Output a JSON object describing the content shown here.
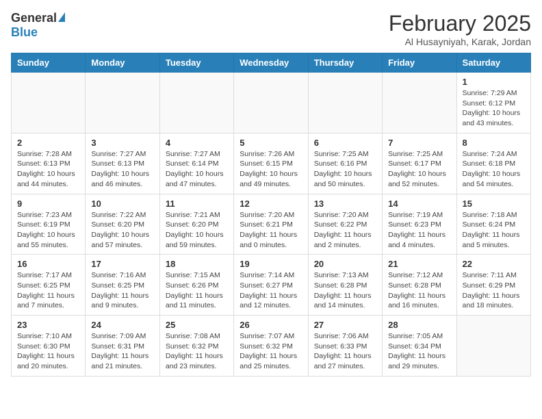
{
  "header": {
    "logo_general": "General",
    "logo_blue": "Blue",
    "month_title": "February 2025",
    "location": "Al Husayniyah, Karak, Jordan"
  },
  "weekdays": [
    "Sunday",
    "Monday",
    "Tuesday",
    "Wednesday",
    "Thursday",
    "Friday",
    "Saturday"
  ],
  "weeks": [
    [
      {
        "day": "",
        "info": ""
      },
      {
        "day": "",
        "info": ""
      },
      {
        "day": "",
        "info": ""
      },
      {
        "day": "",
        "info": ""
      },
      {
        "day": "",
        "info": ""
      },
      {
        "day": "",
        "info": ""
      },
      {
        "day": "1",
        "info": "Sunrise: 7:29 AM\nSunset: 6:12 PM\nDaylight: 10 hours\nand 43 minutes."
      }
    ],
    [
      {
        "day": "2",
        "info": "Sunrise: 7:28 AM\nSunset: 6:13 PM\nDaylight: 10 hours\nand 44 minutes."
      },
      {
        "day": "3",
        "info": "Sunrise: 7:27 AM\nSunset: 6:13 PM\nDaylight: 10 hours\nand 46 minutes."
      },
      {
        "day": "4",
        "info": "Sunrise: 7:27 AM\nSunset: 6:14 PM\nDaylight: 10 hours\nand 47 minutes."
      },
      {
        "day": "5",
        "info": "Sunrise: 7:26 AM\nSunset: 6:15 PM\nDaylight: 10 hours\nand 49 minutes."
      },
      {
        "day": "6",
        "info": "Sunrise: 7:25 AM\nSunset: 6:16 PM\nDaylight: 10 hours\nand 50 minutes."
      },
      {
        "day": "7",
        "info": "Sunrise: 7:25 AM\nSunset: 6:17 PM\nDaylight: 10 hours\nand 52 minutes."
      },
      {
        "day": "8",
        "info": "Sunrise: 7:24 AM\nSunset: 6:18 PM\nDaylight: 10 hours\nand 54 minutes."
      }
    ],
    [
      {
        "day": "9",
        "info": "Sunrise: 7:23 AM\nSunset: 6:19 PM\nDaylight: 10 hours\nand 55 minutes."
      },
      {
        "day": "10",
        "info": "Sunrise: 7:22 AM\nSunset: 6:20 PM\nDaylight: 10 hours\nand 57 minutes."
      },
      {
        "day": "11",
        "info": "Sunrise: 7:21 AM\nSunset: 6:20 PM\nDaylight: 10 hours\nand 59 minutes."
      },
      {
        "day": "12",
        "info": "Sunrise: 7:20 AM\nSunset: 6:21 PM\nDaylight: 11 hours\nand 0 minutes."
      },
      {
        "day": "13",
        "info": "Sunrise: 7:20 AM\nSunset: 6:22 PM\nDaylight: 11 hours\nand 2 minutes."
      },
      {
        "day": "14",
        "info": "Sunrise: 7:19 AM\nSunset: 6:23 PM\nDaylight: 11 hours\nand 4 minutes."
      },
      {
        "day": "15",
        "info": "Sunrise: 7:18 AM\nSunset: 6:24 PM\nDaylight: 11 hours\nand 5 minutes."
      }
    ],
    [
      {
        "day": "16",
        "info": "Sunrise: 7:17 AM\nSunset: 6:25 PM\nDaylight: 11 hours\nand 7 minutes."
      },
      {
        "day": "17",
        "info": "Sunrise: 7:16 AM\nSunset: 6:25 PM\nDaylight: 11 hours\nand 9 minutes."
      },
      {
        "day": "18",
        "info": "Sunrise: 7:15 AM\nSunset: 6:26 PM\nDaylight: 11 hours\nand 11 minutes."
      },
      {
        "day": "19",
        "info": "Sunrise: 7:14 AM\nSunset: 6:27 PM\nDaylight: 11 hours\nand 12 minutes."
      },
      {
        "day": "20",
        "info": "Sunrise: 7:13 AM\nSunset: 6:28 PM\nDaylight: 11 hours\nand 14 minutes."
      },
      {
        "day": "21",
        "info": "Sunrise: 7:12 AM\nSunset: 6:28 PM\nDaylight: 11 hours\nand 16 minutes."
      },
      {
        "day": "22",
        "info": "Sunrise: 7:11 AM\nSunset: 6:29 PM\nDaylight: 11 hours\nand 18 minutes."
      }
    ],
    [
      {
        "day": "23",
        "info": "Sunrise: 7:10 AM\nSunset: 6:30 PM\nDaylight: 11 hours\nand 20 minutes."
      },
      {
        "day": "24",
        "info": "Sunrise: 7:09 AM\nSunset: 6:31 PM\nDaylight: 11 hours\nand 21 minutes."
      },
      {
        "day": "25",
        "info": "Sunrise: 7:08 AM\nSunset: 6:32 PM\nDaylight: 11 hours\nand 23 minutes."
      },
      {
        "day": "26",
        "info": "Sunrise: 7:07 AM\nSunset: 6:32 PM\nDaylight: 11 hours\nand 25 minutes."
      },
      {
        "day": "27",
        "info": "Sunrise: 7:06 AM\nSunset: 6:33 PM\nDaylight: 11 hours\nand 27 minutes."
      },
      {
        "day": "28",
        "info": "Sunrise: 7:05 AM\nSunset: 6:34 PM\nDaylight: 11 hours\nand 29 minutes."
      },
      {
        "day": "",
        "info": ""
      }
    ]
  ]
}
